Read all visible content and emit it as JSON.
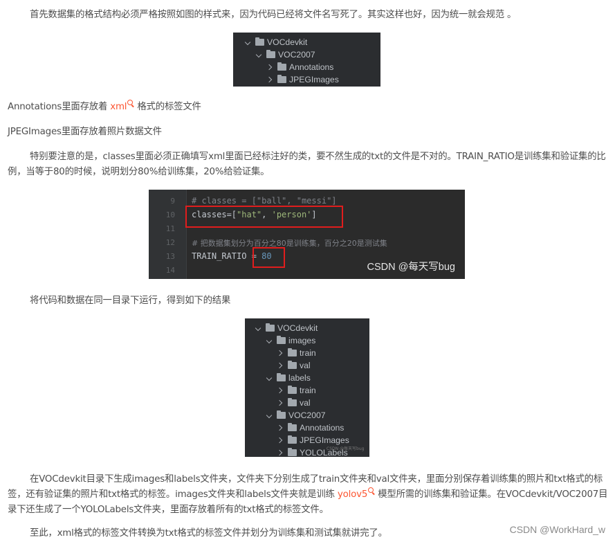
{
  "paragraphs": {
    "p1": "首先数据集的格式结构必须严格按照如图的样式来，因为代码已经将文件名写死了。其实这样也好，因为统一就会规范 。",
    "p2_before": "Annotations里面存放着 ",
    "p2_link": "xml",
    "p2_after": " 格式的标签文件",
    "p3": "JPEGImages里面存放着照片数据文件",
    "p4": "特别要注意的是，classes里面必须正确填写xml里面已经标注好的类，要不然生成的txt的文件是不对的。TRAIN_RATIO是训练集和验证集的比例，当等于80的时候，说明划分80%给训练集，20%给验证集。",
    "p5": "将代码和数据在同一目录下运行，得到如下的结果",
    "p6_before": "在VOCdevkit目录下生成images和labels文件夹，文件夹下分别生成了train文件夹和val文件夹，里面分别保存着训练集的照片和txt格式的标签，还有验证集的照片和txt格式的标签。images文件夹和labels文件夹就是训练 ",
    "p6_link": "yolov5",
    "p6_after": " 模型所需的训练集和验证集。在VOCdevkit/VOC2007目录下还生成了一个YOLOLabels文件夹，里面存放着所有的txt格式的标签文件。",
    "p7": "至此，xml格式的标签文件转换为txt格式的标签文件并划分为训练集和测试集就讲完了。"
  },
  "tree1": [
    {
      "name": "VOCdevkit",
      "depth": 0,
      "state": "open"
    },
    {
      "name": "VOC2007",
      "depth": 1,
      "state": "open"
    },
    {
      "name": "Annotations",
      "depth": 2,
      "state": "closed"
    },
    {
      "name": "JPEGImages",
      "depth": 2,
      "state": "closed"
    }
  ],
  "tree2": [
    {
      "name": "VOCdevkit",
      "depth": 0,
      "state": "open"
    },
    {
      "name": "images",
      "depth": 1,
      "state": "open"
    },
    {
      "name": "train",
      "depth": 2,
      "state": "closed"
    },
    {
      "name": "val",
      "depth": 2,
      "state": "closed"
    },
    {
      "name": "labels",
      "depth": 1,
      "state": "open"
    },
    {
      "name": "train",
      "depth": 2,
      "state": "closed"
    },
    {
      "name": "val",
      "depth": 2,
      "state": "closed"
    },
    {
      "name": "VOC2007",
      "depth": 1,
      "state": "open"
    },
    {
      "name": "Annotations",
      "depth": 2,
      "state": "closed"
    },
    {
      "name": "JPEGImages",
      "depth": 2,
      "state": "closed"
    },
    {
      "name": "YOLOLabels",
      "depth": 2,
      "state": "closed"
    }
  ],
  "code": {
    "line_numbers": [
      "9",
      "10",
      "11",
      "12",
      "13",
      "14"
    ],
    "l9": "# classes = [\"ball\", \"messi\"]",
    "l10_var": "classes",
    "l10_eq": "=[",
    "l10_s1": "\"hat\"",
    "l10_comma": ", ",
    "l10_s2": "'person'",
    "l10_end": "]",
    "l12": "# 把数据集划分为百分之80是训练集，百分之20是测试集",
    "l13_var": "TRAIN_RATIO",
    "l13_eq": " = ",
    "l13_num": "80",
    "watermark": "CSDN @每天写bug"
  },
  "tree2_tiny_watermark": "CSDN @每天写bug",
  "page_watermark": "CSDN @WorkHard_w",
  "colors": {
    "link": "#fc5531",
    "highlight_box": "#e11d1d",
    "ide_bg": "#2b2d30"
  }
}
